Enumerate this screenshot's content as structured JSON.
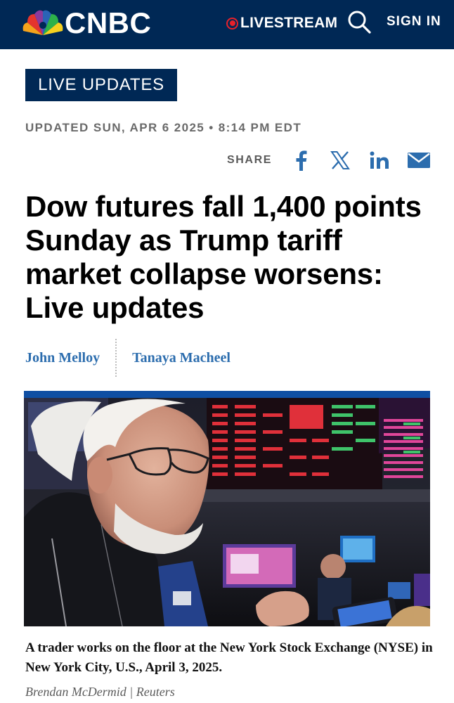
{
  "header": {
    "brand": "CNBC",
    "logo_icon": "nbc-peacock-icon",
    "livestream_label": "LIVESTREAM",
    "signin_label": "SIGN IN",
    "colors": {
      "navy": "#002855",
      "live_red": "#e8212a"
    }
  },
  "article": {
    "badge": "LIVE UPDATES",
    "updated": "UPDATED SUN, APR 6 2025 • 8:14 PM EDT",
    "share_label": "SHARE",
    "share_icons": [
      "facebook-icon",
      "x-icon",
      "linkedin-icon",
      "email-icon"
    ],
    "headline": "Dow futures fall 1,400 points Sunday as Trump tariff market collapse worsens: Live updates",
    "authors": [
      "John Melloy",
      "Tanaya Macheel"
    ],
    "caption": "A trader works on the floor at the New York Stock Exchange (NYSE) in New York City, U.S., April 3, 2025.",
    "credit": "Brendan McDermid | Reuters",
    "colors": {
      "author_link": "#2c6dae",
      "photo_top_bar": "#0f4fa3"
    }
  }
}
